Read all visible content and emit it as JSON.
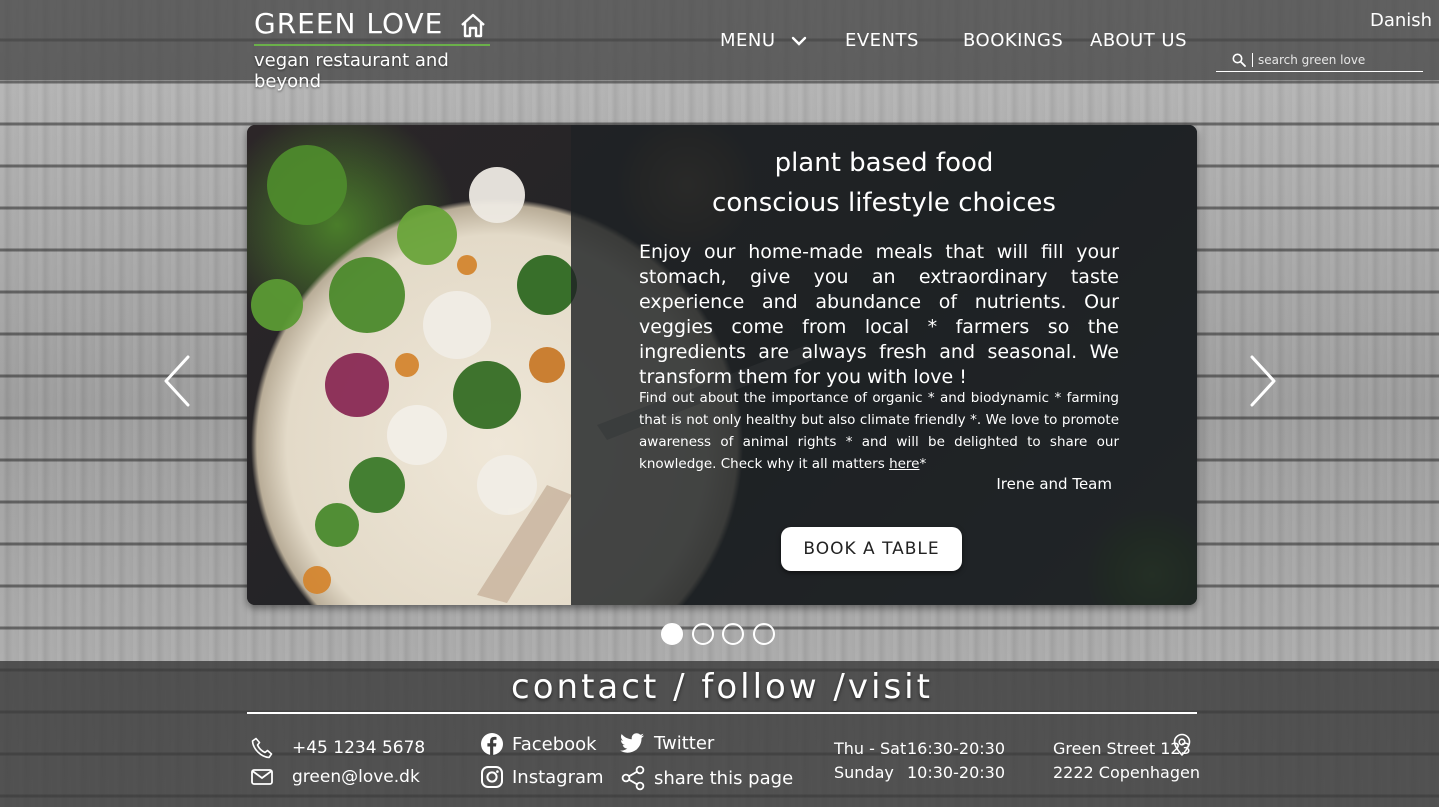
{
  "header": {
    "brand_title": "GREEN LOVE",
    "brand_subtitle": "vegan restaurant and beyond",
    "nav": {
      "menu": "MENU",
      "events": "EVENTS",
      "bookings": "BOOKINGS",
      "about": "ABOUT US"
    },
    "language": "Danish",
    "search_placeholder": "search green love"
  },
  "hero": {
    "heading_line1": "plant based food",
    "heading_line2": "conscious lifestyle choices",
    "paragraph": "Enjoy our home-made meals that will fill your stomach, give you an extraordinary taste experience and abundance of nutrients. Our veggies come from local * farmers so the ingredients are always fresh and seasonal. We transform them for you with love !",
    "paragraph2": "Find out about the importance of organic * and biodynamic * farming that is not only healthy but also climate friendly *. We love to promote awareness of animal rights * and will be delighted to share our knowledge. Check why it all matters",
    "link_text": "here",
    "link_suffix": "*",
    "signature": "Irene and Team",
    "button": "BOOK A TABLE"
  },
  "carousel": {
    "slides": 4,
    "active_index": 0
  },
  "footer": {
    "title": "contact / follow /visit",
    "phone": "+45 1234 5678",
    "email": "green@love.dk",
    "facebook": "Facebook",
    "instagram": "Instagram",
    "twitter": "Twitter",
    "share": "share this page",
    "hours": [
      {
        "days": "Thu - Sat",
        "time": "16:30-20:30"
      },
      {
        "days": "Sunday",
        "time": "10:30-20:30"
      }
    ],
    "address_line1": "Green Street 123",
    "address_line2": "2222 Copenhagen"
  },
  "colors": {
    "accent_green": "#6bb04a",
    "header_bg": "#464646",
    "card_dark": "#1e2224"
  }
}
